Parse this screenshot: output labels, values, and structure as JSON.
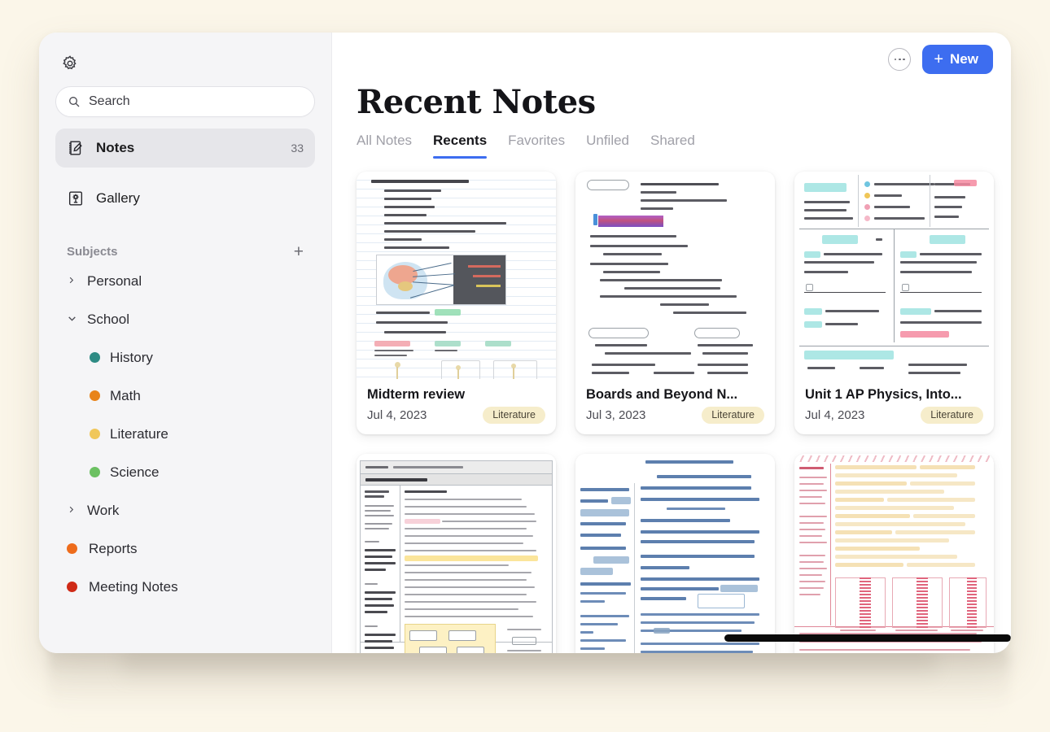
{
  "app": {
    "background_color": "#FBF6E9",
    "accent_color": "#3D6DF0"
  },
  "sidebar": {
    "gear_icon": "gear-icon",
    "search": {
      "icon": "search-icon",
      "placeholder": "Search",
      "value": "Search"
    },
    "nav": [
      {
        "icon": "notebook-pencil-icon",
        "label": "Notes",
        "count": "33",
        "active": true
      },
      {
        "icon": "picture-frame-flower-icon",
        "label": "Gallery",
        "count": "",
        "active": false
      }
    ],
    "subjects": {
      "title": "Subjects",
      "add_label": "+",
      "folders": [
        {
          "label": "Personal",
          "state": "collapsed",
          "chevron": "chevron-right-icon"
        },
        {
          "label": "School",
          "state": "expanded",
          "chevron": "chevron-down-icon"
        }
      ],
      "school_children": [
        {
          "label": "History",
          "color": "#2E8B84"
        },
        {
          "label": "Math",
          "color": "#E8841A"
        },
        {
          "label": "Literature",
          "color": "#F0C75B"
        },
        {
          "label": "Science",
          "color": "#6CC162"
        }
      ],
      "folders_after": [
        {
          "label": "Work",
          "state": "collapsed",
          "chevron": "chevron-right-icon"
        }
      ],
      "tags": [
        {
          "label": "Reports",
          "color": "#EE6C1C"
        },
        {
          "label": "Meeting Notes",
          "color": "#CF2A17"
        }
      ]
    }
  },
  "main": {
    "more_button": "more-options-icon",
    "new_button": {
      "plus": "+",
      "label": "New"
    },
    "title": "Recent Notes",
    "tabs": [
      {
        "label": "All Notes",
        "active": false
      },
      {
        "label": "Recents",
        "active": true
      },
      {
        "label": "Favorites",
        "active": false
      },
      {
        "label": "Unfiled",
        "active": false
      },
      {
        "label": "Shared",
        "active": false
      }
    ],
    "cards": [
      {
        "title": "Midterm review",
        "date": "Jul 4, 2023",
        "tag": "Literature"
      },
      {
        "title": "Boards and Beyond N...",
        "date": "Jul 3, 2023",
        "tag": "Literature"
      },
      {
        "title": "Unit 1 AP Physics, Into...",
        "date": "Jul 4, 2023",
        "tag": "Literature"
      },
      {
        "title": "",
        "date": "",
        "tag": ""
      },
      {
        "title": "",
        "date": "",
        "tag": ""
      },
      {
        "title": "",
        "date": "",
        "tag": ""
      }
    ]
  }
}
